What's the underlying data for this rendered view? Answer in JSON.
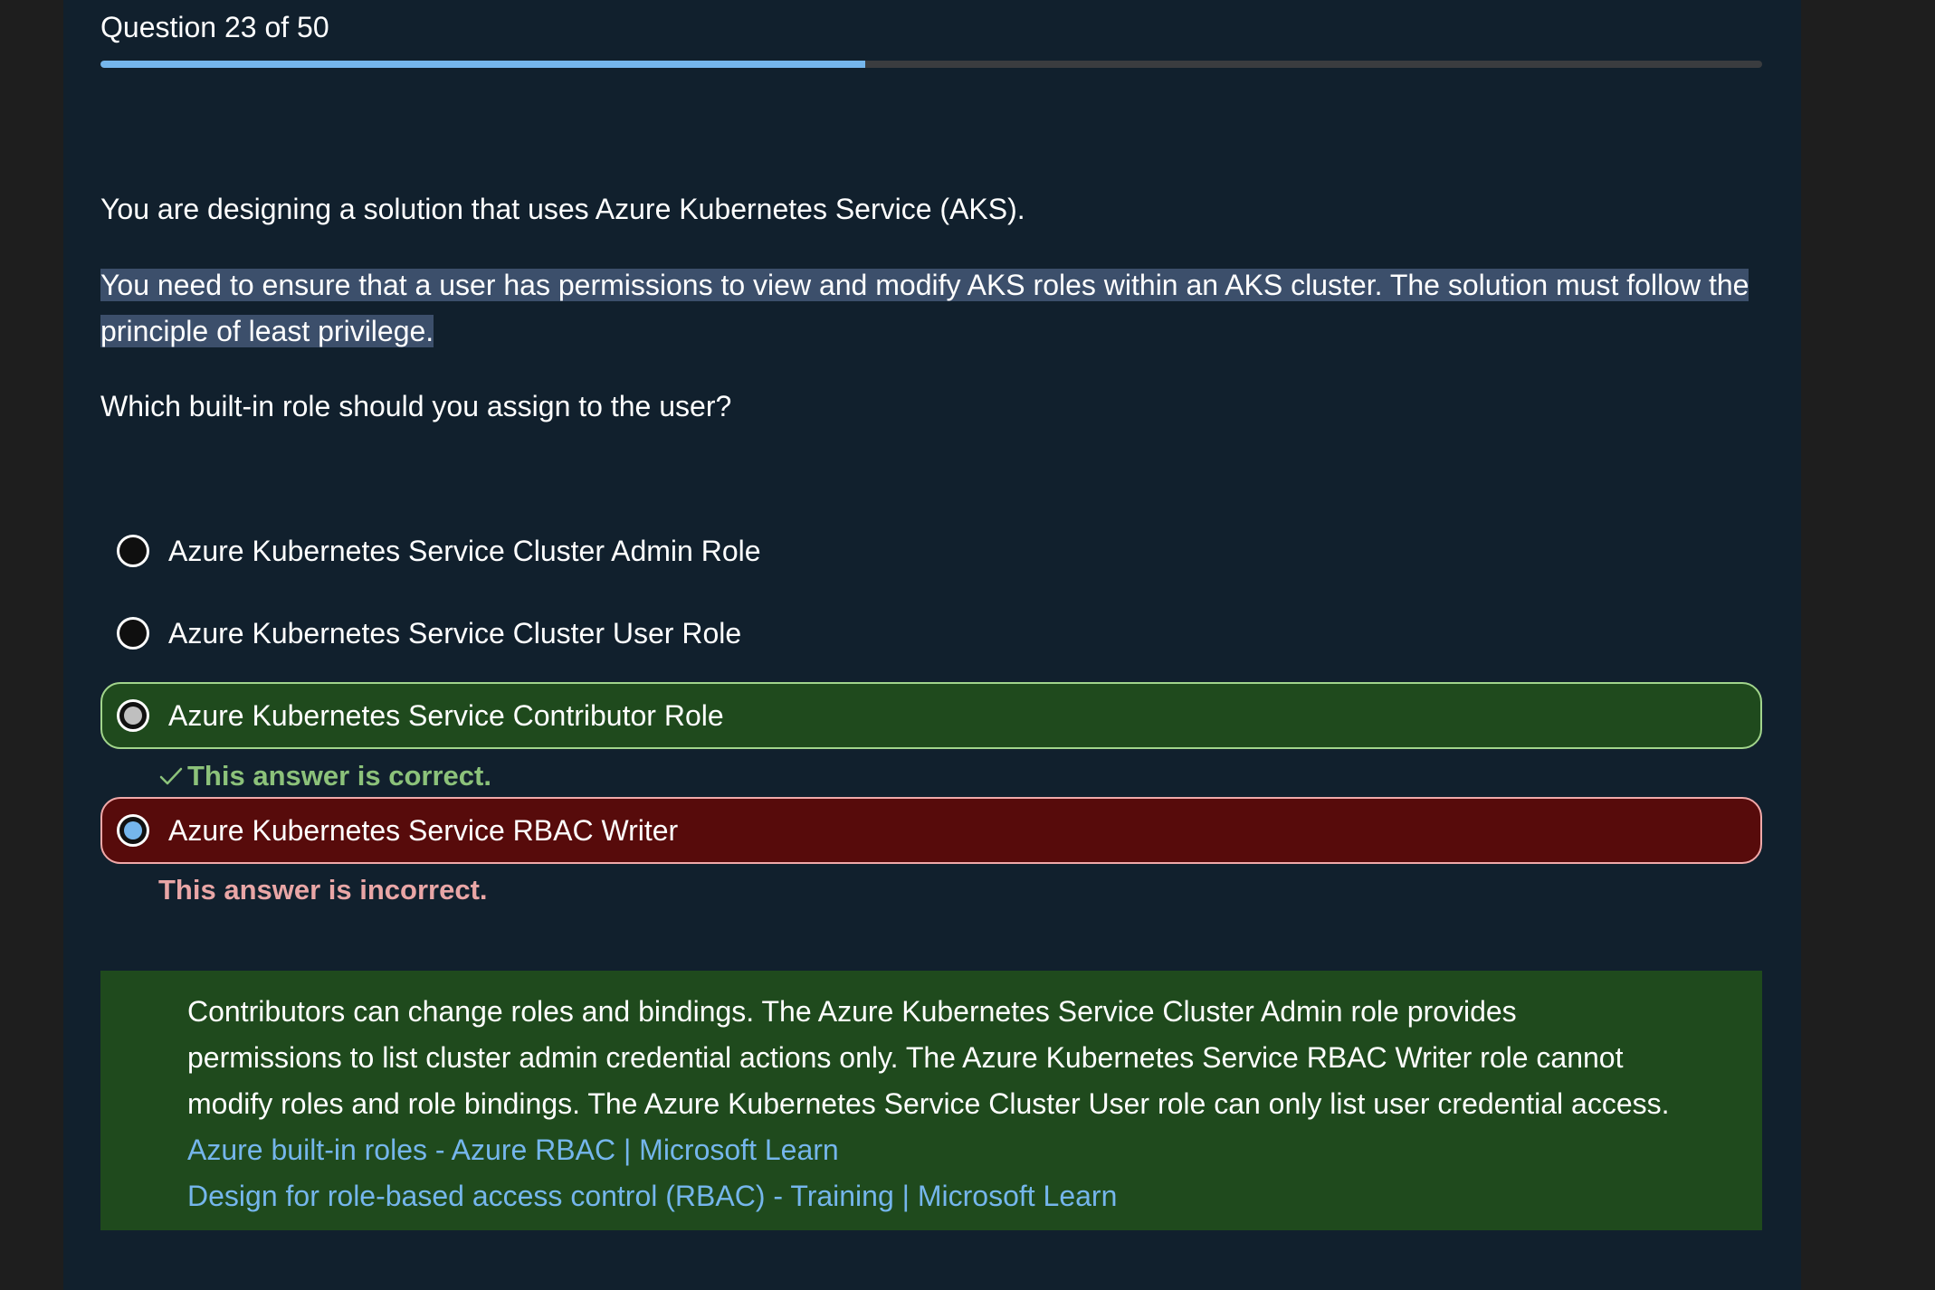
{
  "header": {
    "question_counter": "Question 23 of 50",
    "progress": 0.46
  },
  "question": {
    "paragraph_1": "You are designing a solution that uses Azure Kubernetes Service (AKS).",
    "paragraph_2": "You need to ensure that a user has permissions to view and modify AKS roles within an AKS cluster. The solution must follow the principle of least privilege.",
    "paragraph_3": "Which built-in role should you assign to the user?"
  },
  "options": [
    {
      "label": "Azure Kubernetes Service Cluster Admin Role",
      "state": "unselected"
    },
    {
      "label": "Azure Kubernetes Service Cluster User Role",
      "state": "unselected"
    },
    {
      "label": "Azure Kubernetes Service Contributor Role",
      "state": "correct"
    },
    {
      "label": "Azure Kubernetes Service RBAC Writer",
      "state": "selected-incorrect"
    }
  ],
  "feedback": {
    "correct": "This answer is correct.",
    "incorrect": "This answer is incorrect."
  },
  "explanation": {
    "text": "Contributors can change roles and bindings. The Azure Kubernetes Service Cluster Admin role provides permissions to list cluster admin credential actions only. The Azure Kubernetes Service RBAC Writer role cannot modify roles and role bindings. The Azure Kubernetes Service Cluster User role can only list user credential access.",
    "links": [
      "Azure built-in roles - Azure RBAC | Microsoft Learn",
      "Design for role-based access control (RBAC) - Training | Microsoft Learn"
    ]
  },
  "colors": {
    "page_background": "#11202d",
    "progress_fill": "#75b6ec",
    "correct_background": "#1f4a1d",
    "incorrect_background": "#570b0b",
    "link": "#75b6ec",
    "highlight": "#3c4f6b"
  }
}
